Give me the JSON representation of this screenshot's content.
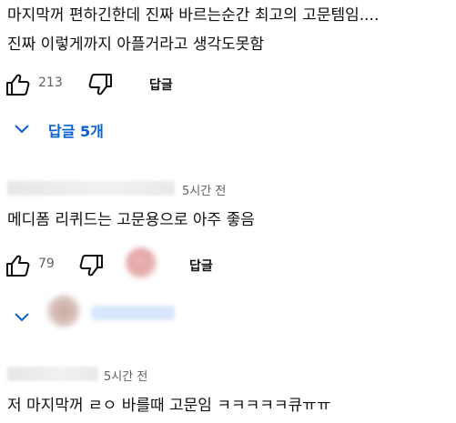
{
  "comments": [
    {
      "lines": [
        "마지막꺼 편하긴한데 진짜 바르는순간 최고의 고문템임....",
        "진짜 이렇게까지 아플거라고 생각도못함"
      ],
      "likes": "213",
      "reply_label": "답글",
      "replies_toggle": "답글 5개"
    },
    {
      "time": "5시간 전",
      "lines": [
        "메디폼 리퀴드는 고문용으로 아주 좋음"
      ],
      "likes": "79",
      "reply_label": "답글"
    },
    {
      "time": "5시간 전",
      "lines": [
        "저 마지막꺼 ㄹㅇ 바를때 고문임 ㅋㅋㅋㅋㅋ큐ㅠㅠ"
      ]
    }
  ],
  "icons": {
    "like": "thumbs-up-icon",
    "dislike": "thumbs-down-icon",
    "expand": "chevron-down-icon"
  },
  "colors": {
    "link": "#065fd4",
    "meta": "#606060"
  }
}
